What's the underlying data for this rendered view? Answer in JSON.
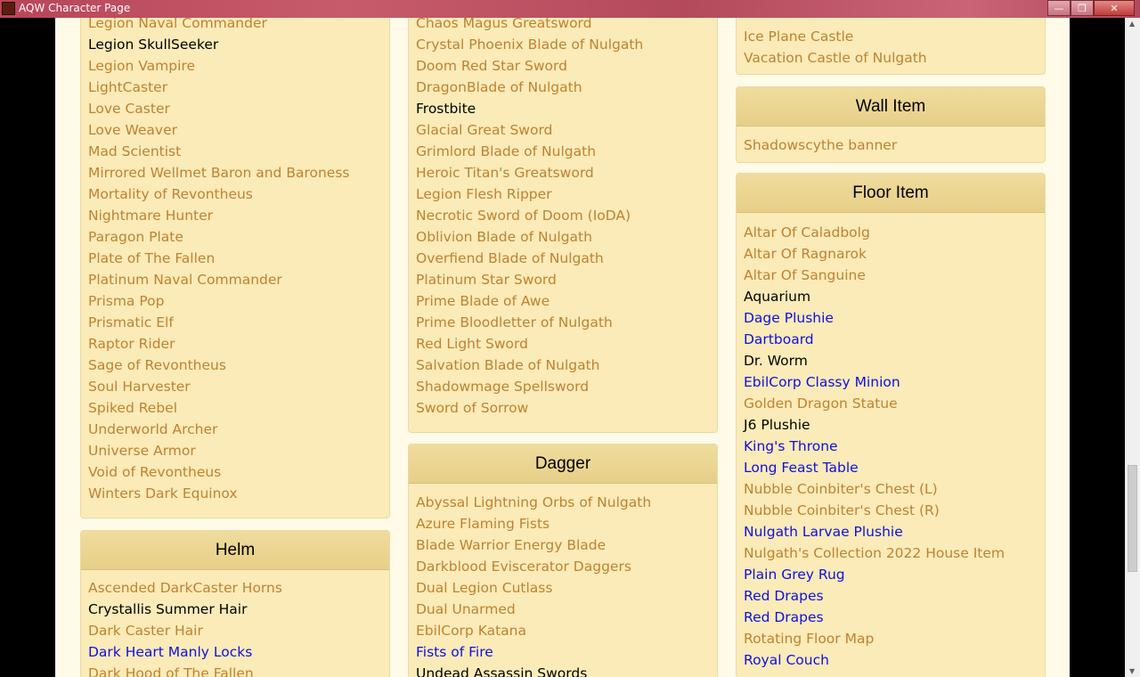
{
  "window": {
    "title": "AQW Character Page",
    "min_glyph": "—",
    "max_glyph": "❐",
    "close_glyph": "✕"
  },
  "scroll": {
    "up_glyph": "▲",
    "down_glyph": "▼"
  },
  "col1": {
    "items": [
      {
        "label": "Legion Naval Commander",
        "kind": "link"
      },
      {
        "label": "Legion SkullSeeker",
        "kind": "plain"
      },
      {
        "label": "Legion Vampire",
        "kind": "link"
      },
      {
        "label": "LightCaster",
        "kind": "link"
      },
      {
        "label": "Love Caster",
        "kind": "link"
      },
      {
        "label": "Love Weaver",
        "kind": "link"
      },
      {
        "label": "Mad Scientist",
        "kind": "link"
      },
      {
        "label": "Mirrored Wellmet Baron and Baroness",
        "kind": "link"
      },
      {
        "label": "Mortality of Revontheus",
        "kind": "link"
      },
      {
        "label": "Nightmare Hunter",
        "kind": "link"
      },
      {
        "label": "Paragon Plate",
        "kind": "link"
      },
      {
        "label": "Plate of The Fallen",
        "kind": "link"
      },
      {
        "label": "Platinum Naval Commander",
        "kind": "link"
      },
      {
        "label": "Prisma Pop",
        "kind": "link"
      },
      {
        "label": "Prismatic Elf",
        "kind": "link"
      },
      {
        "label": "Raptor Rider",
        "kind": "link"
      },
      {
        "label": "Sage of Revontheus",
        "kind": "link"
      },
      {
        "label": "Soul Harvester",
        "kind": "link"
      },
      {
        "label": "Spiked Rebel",
        "kind": "link"
      },
      {
        "label": "Underworld Archer",
        "kind": "link"
      },
      {
        "label": "Universe Armor",
        "kind": "link"
      },
      {
        "label": "Void of Revontheus",
        "kind": "link"
      },
      {
        "label": "Winters Dark Equinox",
        "kind": "link"
      }
    ]
  },
  "helm": {
    "title": "Helm",
    "items": [
      {
        "label": "Ascended DarkCaster Horns",
        "kind": "link"
      },
      {
        "label": "Crystallis Summer Hair",
        "kind": "plain"
      },
      {
        "label": "Dark Caster Hair",
        "kind": "link"
      },
      {
        "label": "Dark Heart Manly Locks",
        "kind": "blue"
      },
      {
        "label": "Dark Hood of The Fallen",
        "kind": "link"
      }
    ]
  },
  "col2": {
    "items": [
      {
        "label": "Chaos Magus Greatsword",
        "kind": "link"
      },
      {
        "label": "Crystal Phoenix Blade of Nulgath",
        "kind": "link"
      },
      {
        "label": "Doom Red Star Sword",
        "kind": "link"
      },
      {
        "label": "DragonBlade of Nulgath",
        "kind": "link"
      },
      {
        "label": "Frostbite",
        "kind": "plain"
      },
      {
        "label": "Glacial Great Sword",
        "kind": "link"
      },
      {
        "label": "Grimlord Blade of Nulgath",
        "kind": "link"
      },
      {
        "label": "Heroic Titan's Greatsword",
        "kind": "link"
      },
      {
        "label": "Legion Flesh Ripper",
        "kind": "link"
      },
      {
        "label": "Necrotic Sword of Doom (IoDA)",
        "kind": "link"
      },
      {
        "label": "Oblivion Blade of Nulgath",
        "kind": "link"
      },
      {
        "label": "Overfiend Blade of Nulgath",
        "kind": "link"
      },
      {
        "label": "Platinum Star Sword",
        "kind": "link"
      },
      {
        "label": "Prime Blade of Awe",
        "kind": "link"
      },
      {
        "label": "Prime Bloodletter of Nulgath",
        "kind": "link"
      },
      {
        "label": "Red Light Sword",
        "kind": "link"
      },
      {
        "label": "Salvation Blade of Nulgath",
        "kind": "link"
      },
      {
        "label": "Shadowmage Spellsword",
        "kind": "link"
      },
      {
        "label": "Sword of Sorrow",
        "kind": "link"
      }
    ]
  },
  "dagger": {
    "title": "Dagger",
    "items": [
      {
        "label": "Abyssal Lightning Orbs of Nulgath",
        "kind": "link"
      },
      {
        "label": "Azure Flaming Fists",
        "kind": "link"
      },
      {
        "label": "Blade Warrior Energy Blade",
        "kind": "link"
      },
      {
        "label": "Darkblood Eviscerator Daggers",
        "kind": "link"
      },
      {
        "label": "Dual Legion Cutlass",
        "kind": "link"
      },
      {
        "label": "Dual Unarmed",
        "kind": "link"
      },
      {
        "label": "EbilCorp Katana",
        "kind": "link"
      },
      {
        "label": "Fists of Fire",
        "kind": "blue"
      },
      {
        "label": "Undead Assassin Swords",
        "kind": "plain"
      }
    ]
  },
  "col3": {
    "items": [
      {
        "label": "Ice Plane Castle",
        "kind": "link"
      },
      {
        "label": "Vacation Castle of Nulgath",
        "kind": "link"
      }
    ]
  },
  "wall": {
    "title": "Wall Item",
    "items": [
      {
        "label": "Shadowscythe banner",
        "kind": "link"
      }
    ]
  },
  "floor": {
    "title": "Floor Item",
    "items": [
      {
        "label": "Altar Of Caladbolg",
        "kind": "link"
      },
      {
        "label": "Altar Of Ragnarok",
        "kind": "link"
      },
      {
        "label": "Altar Of Sanguine",
        "kind": "link"
      },
      {
        "label": "Aquarium",
        "kind": "plain"
      },
      {
        "label": "Dage Plushie",
        "kind": "blue"
      },
      {
        "label": "Dartboard",
        "kind": "blue"
      },
      {
        "label": "Dr. Worm",
        "kind": "plain"
      },
      {
        "label": "EbilCorp Classy Minion",
        "kind": "blue"
      },
      {
        "label": "Golden Dragon Statue",
        "kind": "link"
      },
      {
        "label": "J6 Plushie",
        "kind": "plain"
      },
      {
        "label": "King's Throne",
        "kind": "blue"
      },
      {
        "label": "Long Feast Table",
        "kind": "blue"
      },
      {
        "label": "Nubble Coinbiter's Chest (L)",
        "kind": "link"
      },
      {
        "label": "Nubble Coinbiter's Chest (R)",
        "kind": "link"
      },
      {
        "label": "Nulgath Larvae Plushie",
        "kind": "blue"
      },
      {
        "label": "Nulgath's Collection 2022 House Item",
        "kind": "link"
      },
      {
        "label": "Plain Grey Rug",
        "kind": "blue"
      },
      {
        "label": "Red Drapes",
        "kind": "blue"
      },
      {
        "label": "Red Drapes",
        "kind": "blue"
      },
      {
        "label": "Rotating Floor Map",
        "kind": "link"
      },
      {
        "label": "Royal Couch",
        "kind": "blue"
      }
    ]
  },
  "colors": {
    "link": "#c0822f",
    "plain": "#000000",
    "blue": "#1010dd",
    "panel": "#faebb8",
    "header": "#e6cf88"
  }
}
